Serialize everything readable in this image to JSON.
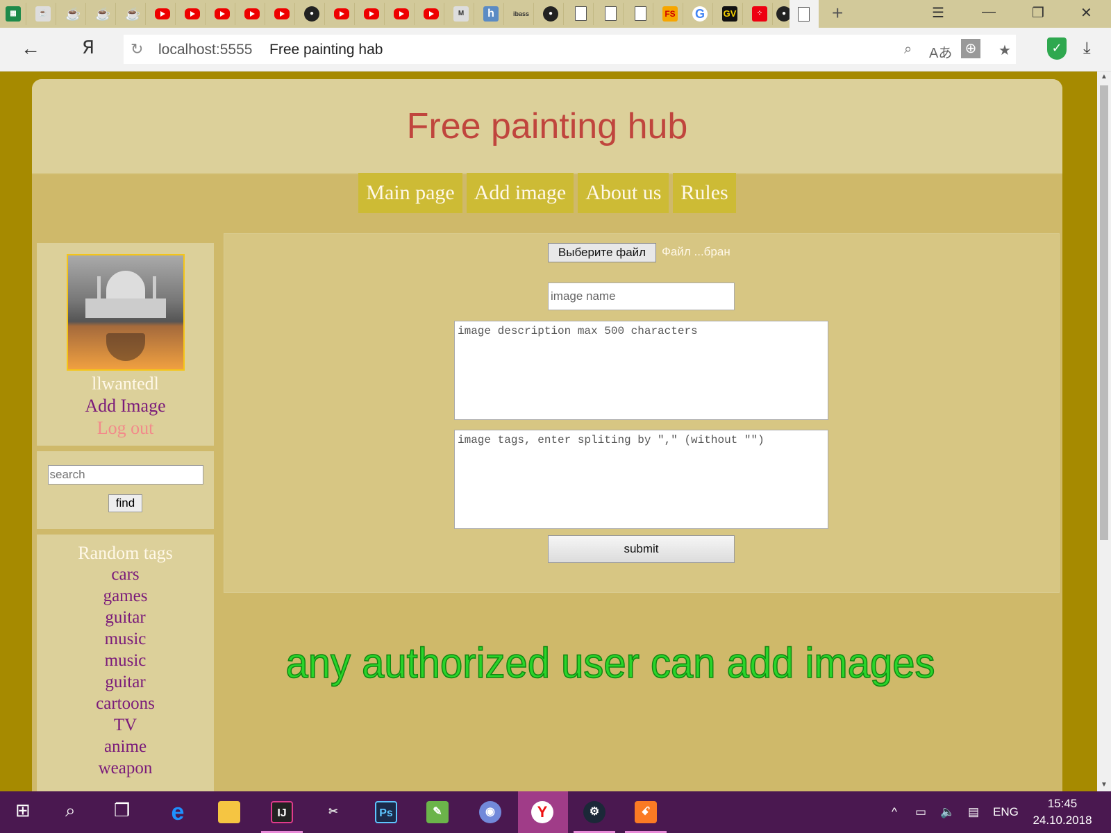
{
  "browser": {
    "url": "localhost:5555",
    "page_title": "Free painting hab",
    "yandex_glyph": "Я"
  },
  "site": {
    "title": "Free painting hub",
    "nav": [
      "Main page",
      "Add image",
      "About us",
      "Rules"
    ]
  },
  "user": {
    "name": "llwantedl",
    "add_image": "Add Image",
    "logout": "Log out"
  },
  "search": {
    "placeholder": "search",
    "find_label": "find"
  },
  "tags": {
    "title": "Random tags",
    "items": [
      "cars",
      "games",
      "guitar",
      "music",
      "music",
      "guitar",
      "cartoons",
      "TV",
      "anime",
      "weapon"
    ]
  },
  "form": {
    "file_button": "Выберите файл",
    "file_status": "Файл ...бран",
    "name_placeholder": "image name",
    "description_placeholder": "image description max 500 characters",
    "tags_placeholder": "image tags, enter spliting by \",\" (without \"\")",
    "submit_label": "submit"
  },
  "notice": "any authorized user can add images",
  "taskbar": {
    "language": "ENG",
    "time": "15:45",
    "date": "24.10.2018"
  },
  "tab_icons": [
    "sheets-icon",
    "jar-icon",
    "java-icon",
    "java-icon",
    "java-icon",
    "youtube-icon",
    "youtube-icon",
    "youtube-icon",
    "youtube-icon",
    "youtube-icon",
    "github-icon",
    "youtube-icon",
    "youtube-icon",
    "youtube-icon",
    "youtube-icon",
    "mask-icon",
    "h-icon",
    "ibass-icon",
    "github-icon",
    "document-icon",
    "document-icon",
    "document-icon",
    "fs-icon",
    "google-icon",
    "gv-icon",
    "dice-icon",
    "github-icon"
  ]
}
